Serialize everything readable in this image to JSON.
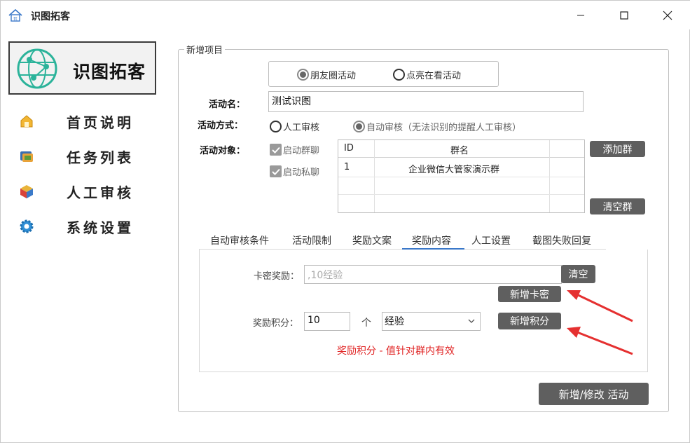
{
  "window": {
    "title": "识图拓客",
    "min_glyph": "—",
    "max_glyph": "☐",
    "close_glyph": "✕"
  },
  "sidebar": {
    "logo_text": "识图拓客",
    "items": [
      {
        "label": "首页说明",
        "icon": "home-icon"
      },
      {
        "label": "任务列表",
        "icon": "tasks-icon"
      },
      {
        "label": "人工审核",
        "icon": "review-icon"
      },
      {
        "label": "系统设置",
        "icon": "gear-icon"
      }
    ]
  },
  "form": {
    "group_title": "新增项目",
    "activity_types": [
      {
        "label": "朋友圈活动",
        "checked": true
      },
      {
        "label": "点亮在看活动",
        "checked": false
      }
    ],
    "name_label": "活动名：",
    "name_value": "测试识图",
    "mode_label": "活动方式：",
    "modes": [
      {
        "label": "人工审核",
        "checked": false
      },
      {
        "label": "自动审核（无法识别的提醒人工审核）",
        "checked": true
      }
    ],
    "target_label": "活动对象：",
    "targets": [
      {
        "label": "启动群聊",
        "checked": true
      },
      {
        "label": "启动私聊",
        "checked": true
      }
    ],
    "grid": {
      "columns": [
        "ID",
        "群名"
      ],
      "rows": [
        {
          "id": "1",
          "name": "企业微信大管家演示群"
        }
      ]
    },
    "add_group_button": "添加群",
    "clear_group_button": "清空群"
  },
  "tabs": {
    "items": [
      "自动审核条件",
      "活动限制",
      "奖励文案",
      "奖励内容",
      "人工设置",
      "截图失败回复"
    ],
    "active_index": 3
  },
  "reward": {
    "card_label": "卡密奖励：",
    "card_placeholder": ",10经验",
    "clear_button": "清空",
    "add_card_button": "新增卡密",
    "points_label": "奖励积分：",
    "points_value": "10",
    "points_unit": "个",
    "points_type": "经验",
    "add_points_button": "新增积分",
    "hint": "奖励积分 - 值针对群内有效"
  },
  "submit_button": "新增/修改 活动",
  "colors": {
    "accent_blue": "#3a78c9",
    "dark_button": "#5f5f5f",
    "hint_red": "#e02323",
    "arrow_red": "#e53030"
  }
}
